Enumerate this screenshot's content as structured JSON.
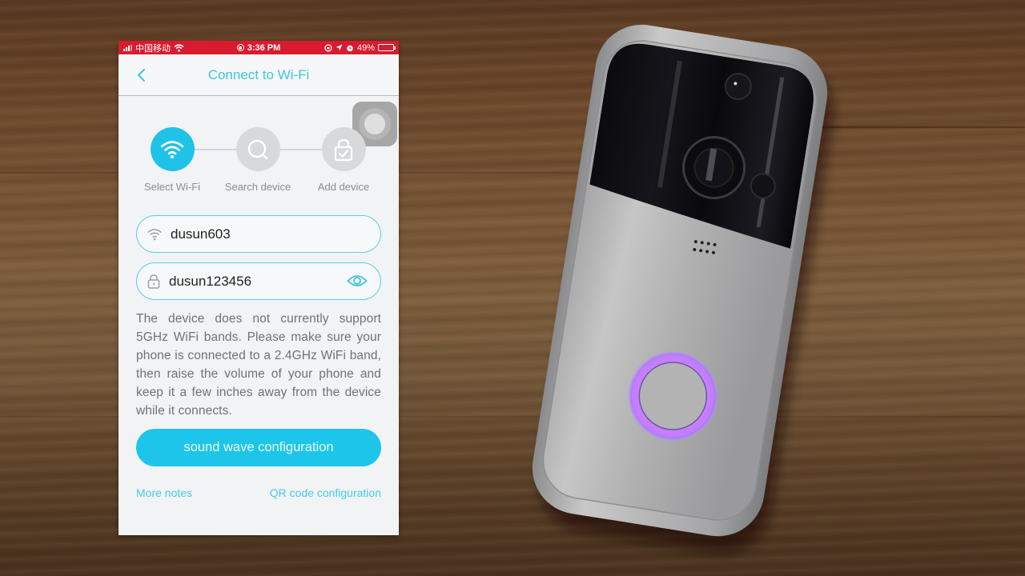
{
  "status_bar": {
    "carrier": "中国移动",
    "time": "3:36 PM",
    "battery_percent": "49%",
    "battery_level": 0.49,
    "bar_color": "#d91b2f"
  },
  "nav": {
    "title": "Connect to Wi-Fi",
    "back_icon": "chevron-left-icon"
  },
  "steps": [
    {
      "label": "Select Wi-Fi",
      "icon": "wifi-icon",
      "active": true
    },
    {
      "label": "Search device",
      "icon": "search-icon",
      "active": false
    },
    {
      "label": "Add device",
      "icon": "lock-check-icon",
      "active": false
    }
  ],
  "form": {
    "ssid_value": "dusun603",
    "password_value": "dusun123456"
  },
  "notice": "The device does not currently support 5GHz WiFi bands. Please make sure your phone is connected to a 2.4GHz WiFi band, then raise the volume of your phone and keep it a few inches away from the device while it connects.",
  "actions": {
    "primary_label": "sound wave configuration",
    "more_notes": "More notes",
    "qr_config": "QR code configuration"
  },
  "colors": {
    "accent": "#1ec5ea",
    "title": "#3ec4e0",
    "inactive_step": "#d8d9db"
  },
  "scene": {
    "object": "video doorbell",
    "button_ring_color": "#c77dff"
  }
}
